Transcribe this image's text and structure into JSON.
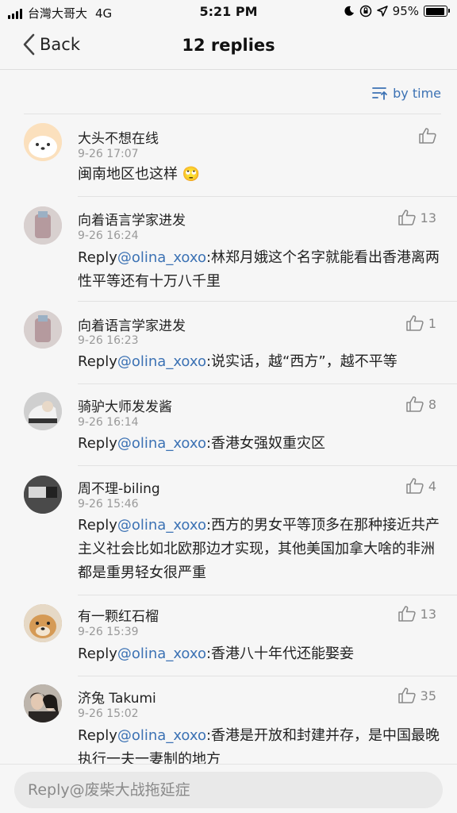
{
  "status_bar": {
    "carrier": "台灣大哥大",
    "network": "4G",
    "time": "5:21 PM",
    "battery": "95%",
    "battery_level": 0.95
  },
  "nav": {
    "back_label": "Back",
    "title": "12 replies"
  },
  "sort": {
    "label": "by time"
  },
  "comments": [
    {
      "name": "大头不想在线",
      "time": "9-26 17:07",
      "likes": "",
      "reply": "",
      "mention": "",
      "text": "闽南地区也这样 🙄"
    },
    {
      "name": "向着语言学家进发",
      "time": "9-26 16:24",
      "likes": "13",
      "reply": "Reply",
      "mention": "@olina_xoxo",
      "text": ":林郑月娥这个名字就能看出香港离两性平等还有十万八千里"
    },
    {
      "name": "向着语言学家进发",
      "time": "9-26 16:23",
      "likes": "1",
      "reply": "Reply",
      "mention": "@olina_xoxo",
      "text": ":说实话，越“西方”，越不平等"
    },
    {
      "name": "骑驴大师发发酱",
      "time": "9-26 16:14",
      "likes": "8",
      "reply": "Reply",
      "mention": "@olina_xoxo",
      "text": ":香港女强奴重灾区"
    },
    {
      "name": "周不理-biling",
      "time": "9-26 15:46",
      "likes": "4",
      "reply": "Reply",
      "mention": "@olina_xoxo",
      "text": ":西方的男女平等顶多在那种接近共产主义社会比如北欧那边才实现，其他美国加拿大啥的非洲都是重男轻女很严重"
    },
    {
      "name": "有一颗红石榴",
      "time": "9-26 15:39",
      "likes": "13",
      "reply": "Reply",
      "mention": "@olina_xoxo",
      "text": ":香港八十年代还能娶妾"
    },
    {
      "name": "济兔 Takumi",
      "time": "9-26 15:02",
      "likes": "35",
      "reply": "Reply",
      "mention": "@olina_xoxo",
      "text": ":香港是开放和封建并存，是中国最晚执行一夫一妻制的地方"
    }
  ],
  "input": {
    "placeholder": "Reply@废柴大战拖延症"
  }
}
